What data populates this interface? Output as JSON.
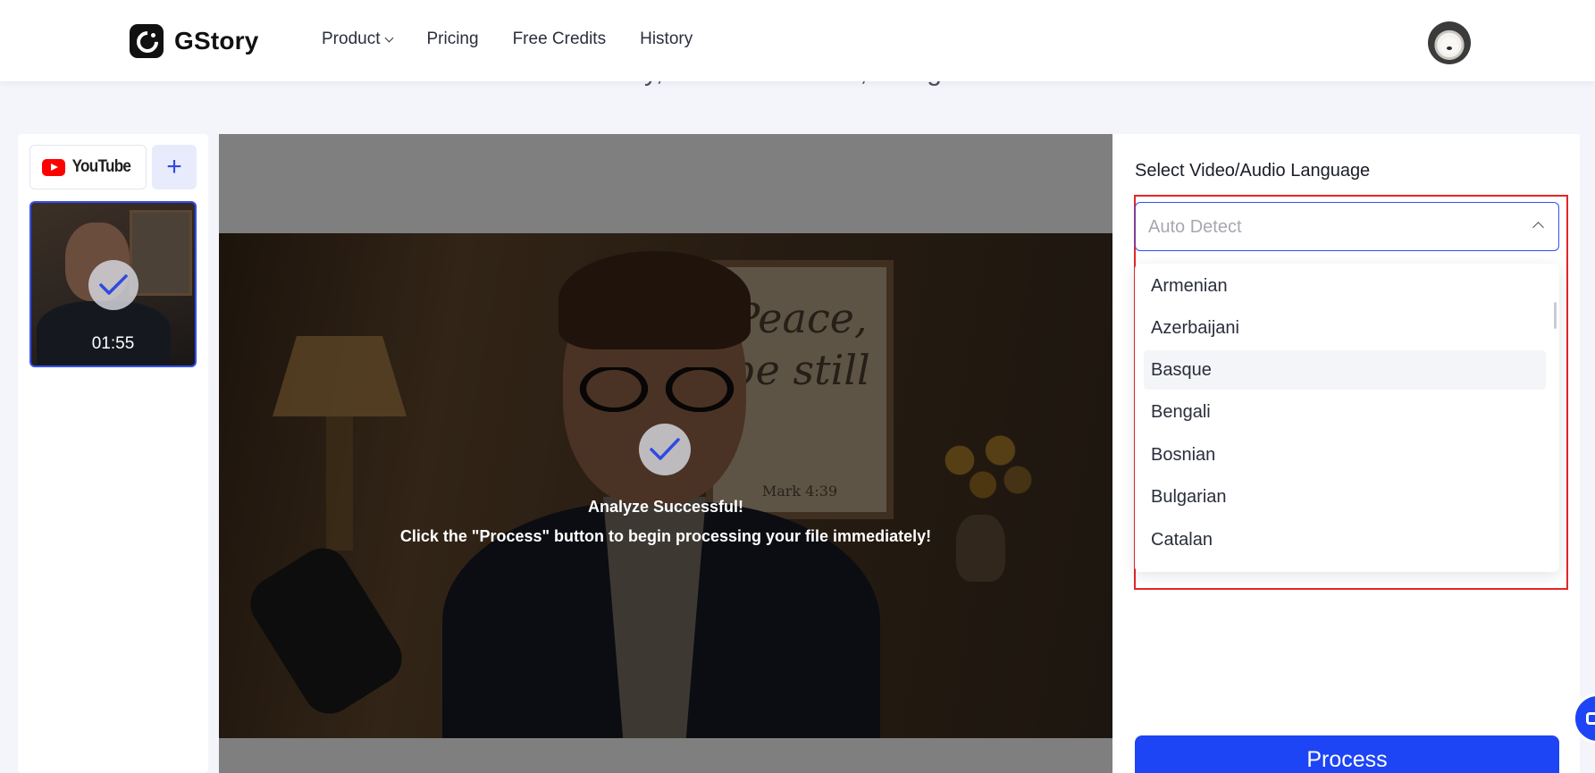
{
  "header": {
    "brand_name": "GStory",
    "nav": [
      {
        "label": "Product",
        "has_dropdown": true
      },
      {
        "label": "Pricing"
      },
      {
        "label": "Free Credits"
      },
      {
        "label": "History"
      }
    ],
    "avatar_icon": "user-avatar-dog-headphones"
  },
  "hero": {
    "partial_text": "accessibility, viewer retention, and global reach."
  },
  "sidebar": {
    "source_button_logo": "YouTube",
    "add_button_label": "+",
    "files": [
      {
        "duration": "01:55",
        "selected": true,
        "analyzed": true
      }
    ]
  },
  "video": {
    "poster_text": "Peace, be still",
    "poster_ref": "Mark 4:39",
    "status_title": "Analyze Successful!",
    "status_desc": "Click the \"Process\" button to begin processing your file immediately!"
  },
  "settings": {
    "language_label": "Select Video/Audio Language",
    "selected_language": "Auto Detect",
    "dropdown_open": true,
    "language_options": [
      {
        "label": "Armenian"
      },
      {
        "label": "Azerbaijani"
      },
      {
        "label": "Basque",
        "hovered": true
      },
      {
        "label": "Bengali"
      },
      {
        "label": "Bosnian"
      },
      {
        "label": "Bulgarian"
      },
      {
        "label": "Catalan"
      }
    ],
    "process_label": "Process"
  },
  "colors": {
    "accent": "#1d44f5",
    "highlight_border": "#e32626",
    "selected_thumb_border": "#3350f0"
  }
}
